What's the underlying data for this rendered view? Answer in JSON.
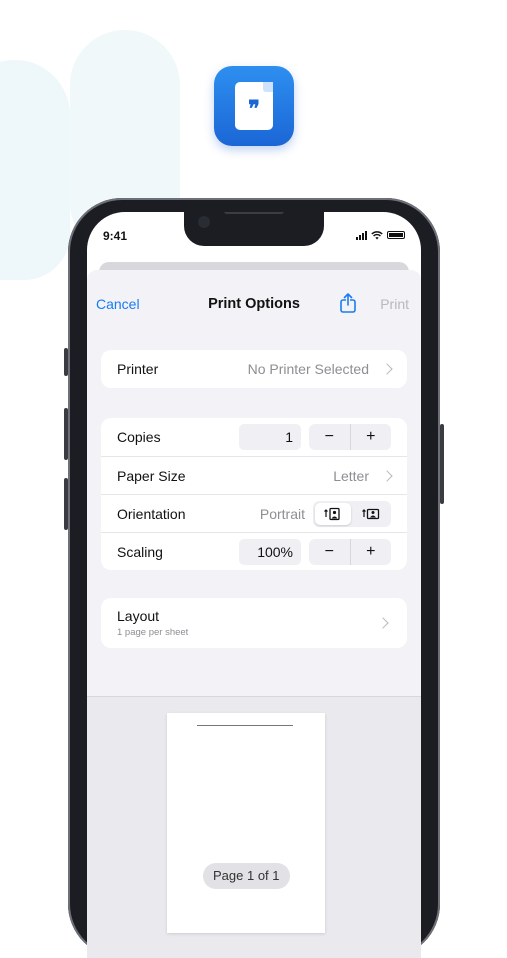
{
  "status_bar": {
    "time": "9:41"
  },
  "nav": {
    "cancel": "Cancel",
    "title": "Print Options",
    "print": "Print"
  },
  "printer": {
    "label": "Printer",
    "value": "No Printer Selected"
  },
  "copies": {
    "label": "Copies",
    "value": "1",
    "minus": "−",
    "plus": "+"
  },
  "paper_size": {
    "label": "Paper Size",
    "value": "Letter"
  },
  "orientation": {
    "label": "Orientation",
    "value": "Portrait"
  },
  "scaling": {
    "label": "Scaling",
    "value": "100%",
    "minus": "−",
    "plus": "+"
  },
  "layout": {
    "label": "Layout",
    "subtitle": "1 page per sheet"
  },
  "preview": {
    "page_indicator": "Page 1 of 1"
  },
  "colors": {
    "accent": "#1a7cf2",
    "icon_blue": "#1b66d6",
    "sheet_bg": "#f2f2f7"
  },
  "icons": [
    "quote-document-icon",
    "share-icon",
    "chevron-right-icon",
    "portrait-orientation-icon",
    "landscape-orientation-icon"
  ]
}
